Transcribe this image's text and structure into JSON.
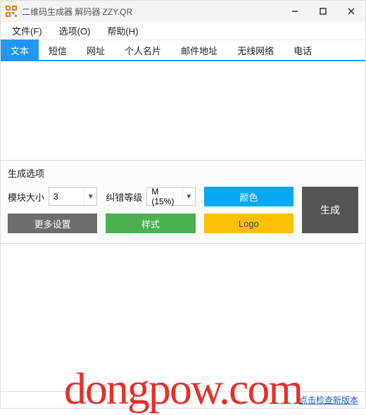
{
  "titlebar": {
    "title": "二维码生成器 解码器 ZZY.QR"
  },
  "menu": {
    "file": "文件(F)",
    "options": "选项(O)",
    "help": "帮助(H)"
  },
  "tabs": {
    "text": "文本",
    "sms": "短信",
    "url": "网址",
    "vcard": "个人名片",
    "mail": "邮件地址",
    "wifi": "无线网络",
    "phone": "电话"
  },
  "textarea": {
    "value": ""
  },
  "opts": {
    "title": "生成选项",
    "module_label": "模块大小",
    "module_value": "3",
    "ec_label": "纠错等级",
    "ec_value": "M (15%)",
    "color_btn": "颜色",
    "more_btn": "更多设置",
    "style_btn": "样式",
    "logo_btn": "Logo",
    "generate_btn": "生成"
  },
  "status": {
    "update_link": "点击检查新版本"
  },
  "watermark": "dongpow.com"
}
